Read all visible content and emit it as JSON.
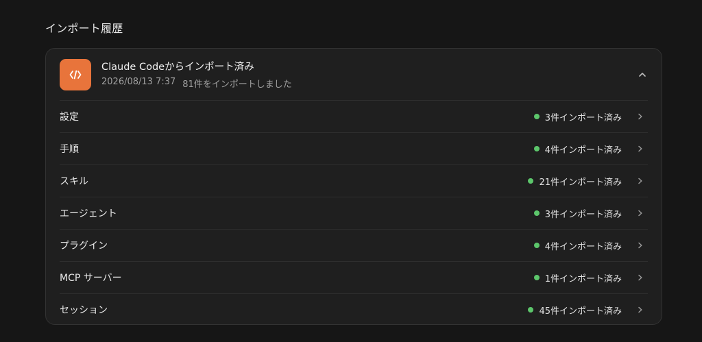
{
  "colors": {
    "background": "#161616",
    "accent": "#e8743b",
    "status_dot": "#5cc66b"
  },
  "section_title": "インポート履歴",
  "import_card": {
    "icon": "code-brackets-icon",
    "title": "Claude Codeからインポート済み",
    "timestamp": "2026/08/13 7:37",
    "summary": "81件をインポートしました",
    "collapse_icon": "chevron-up-icon"
  },
  "rows": [
    {
      "label": "設定",
      "status": "3件インポート済み"
    },
    {
      "label": "手順",
      "status": "4件インポート済み"
    },
    {
      "label": "スキル",
      "status": "21件インポート済み"
    },
    {
      "label": "エージェント",
      "status": "3件インポート済み"
    },
    {
      "label": "プラグイン",
      "status": "4件インポート済み"
    },
    {
      "label": "MCP サーバー",
      "status": "1件インポート済み"
    },
    {
      "label": "セッション",
      "status": "45件インポート済み"
    }
  ]
}
